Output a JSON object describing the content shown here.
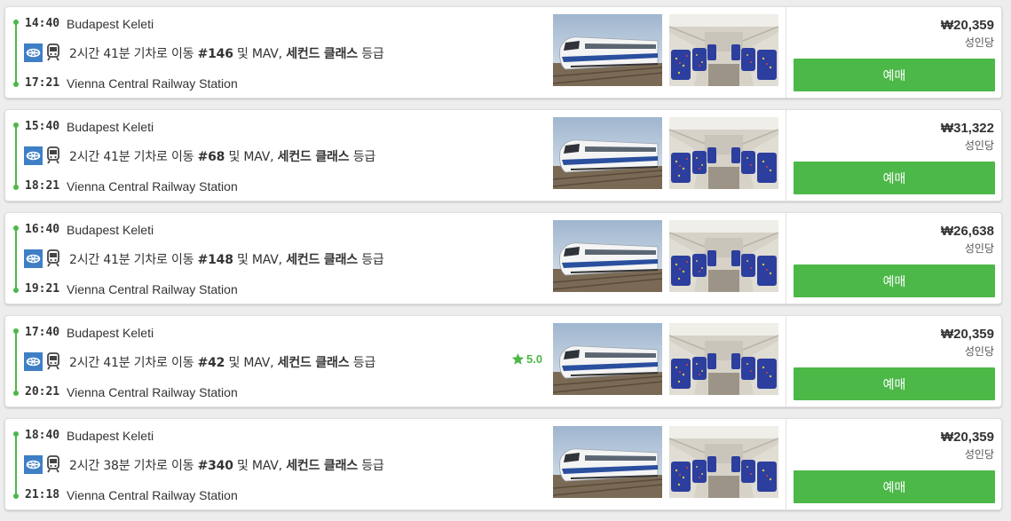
{
  "rows": [
    {
      "dep_time": "14:40",
      "dep_station": "Budapest Keleti",
      "arr_time": "17:21",
      "arr_station": "Vienna Central Railway Station",
      "dur": "2시간 41분 기차로 이동",
      "num": "#146",
      "mid": "및 MAV,",
      "cls": "세컨드 클래스",
      "tail": "등급",
      "rating": "",
      "price": "₩20,359",
      "per": "성인당",
      "btn": "예매"
    },
    {
      "dep_time": "15:40",
      "dep_station": "Budapest Keleti",
      "arr_time": "18:21",
      "arr_station": "Vienna Central Railway Station",
      "dur": "2시간 41분 기차로 이동",
      "num": "#68",
      "mid": "및 MAV,",
      "cls": "세컨드 클래스",
      "tail": "등급",
      "rating": "",
      "price": "₩31,322",
      "per": "성인당",
      "btn": "예매"
    },
    {
      "dep_time": "16:40",
      "dep_station": "Budapest Keleti",
      "arr_time": "19:21",
      "arr_station": "Vienna Central Railway Station",
      "dur": "2시간 41분 기차로 이동",
      "num": "#148",
      "mid": "및 MAV,",
      "cls": "세컨드 클래스",
      "tail": "등급",
      "rating": "",
      "price": "₩26,638",
      "per": "성인당",
      "btn": "예매"
    },
    {
      "dep_time": "17:40",
      "dep_station": "Budapest Keleti",
      "arr_time": "20:21",
      "arr_station": "Vienna Central Railway Station",
      "dur": "2시간 41분 기차로 이동",
      "num": "#42",
      "mid": "및 MAV,",
      "cls": "세컨드 클래스",
      "tail": "등급",
      "rating": "5.0",
      "price": "₩20,359",
      "per": "성인당",
      "btn": "예매"
    },
    {
      "dep_time": "18:40",
      "dep_station": "Budapest Keleti",
      "arr_time": "21:18",
      "arr_station": "Vienna Central Railway Station",
      "dur": "2시간 38분 기차로 이동",
      "num": "#340",
      "mid": "및 MAV,",
      "cls": "세컨드 클래스",
      "tail": "등급",
      "rating": "",
      "price": "₩20,359",
      "per": "성인당",
      "btn": "예매"
    }
  ],
  "colors": {
    "accent": "#4cb848",
    "operator": "#3f7fc6",
    "seat": "#2c3e9e"
  },
  "icons": {
    "operator": "mav-logo-icon",
    "train": "train-icon",
    "rating": "star-icon"
  }
}
